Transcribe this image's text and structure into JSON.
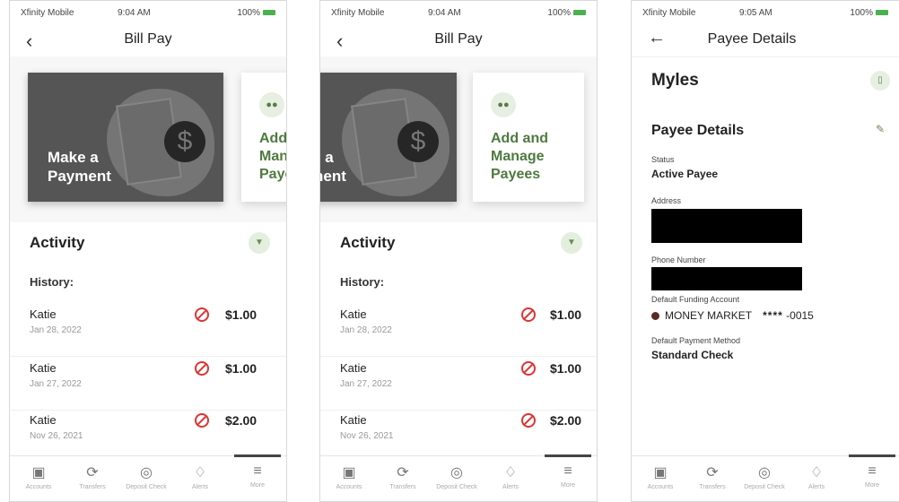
{
  "status": {
    "carrier": "Xfinity Mobile",
    "time_a": "9:04 AM",
    "time_b": "9:05 AM",
    "battery": "100%"
  },
  "screen1": {
    "title": "Bill Pay",
    "cards": {
      "payment": "Make a Payment",
      "payees": "Add and Manage Payees"
    },
    "activity_title": "Activity",
    "history_label": "History:",
    "history": [
      {
        "name": "Katie",
        "date": "Jan 28, 2022",
        "amount": "$1.00"
      },
      {
        "name": "Katie",
        "date": "Jan 27, 2022",
        "amount": "$1.00"
      },
      {
        "name": "Katie",
        "date": "Nov 26, 2021",
        "amount": "$2.00"
      }
    ]
  },
  "screen3": {
    "title": "Payee Details",
    "payee_name": "Myles",
    "section_title": "Payee Details",
    "fields": {
      "status_label": "Status",
      "status_value": "Active Payee",
      "address_label": "Address",
      "phone_label": "Phone Number",
      "funding_label": "Default Funding Account",
      "funding_account": "MONEY MARKET",
      "funding_mask": "****",
      "funding_suffix": "-0015",
      "method_label": "Default Payment Method",
      "method_value": "Standard Check"
    }
  },
  "tabbar": {
    "tabs": [
      {
        "label": "Accounts",
        "icon": "accounts-icon"
      },
      {
        "label": "Transfers",
        "icon": "transfers-icon"
      },
      {
        "label": "Deposit Check",
        "icon": "camera-icon"
      },
      {
        "label": "Alerts",
        "icon": "bell-icon"
      },
      {
        "label": "More",
        "icon": "menu-icon"
      }
    ]
  },
  "colors": {
    "brand_green": "#4e7a3e",
    "cancel_red": "#d33333",
    "card_dark": "#555555"
  }
}
